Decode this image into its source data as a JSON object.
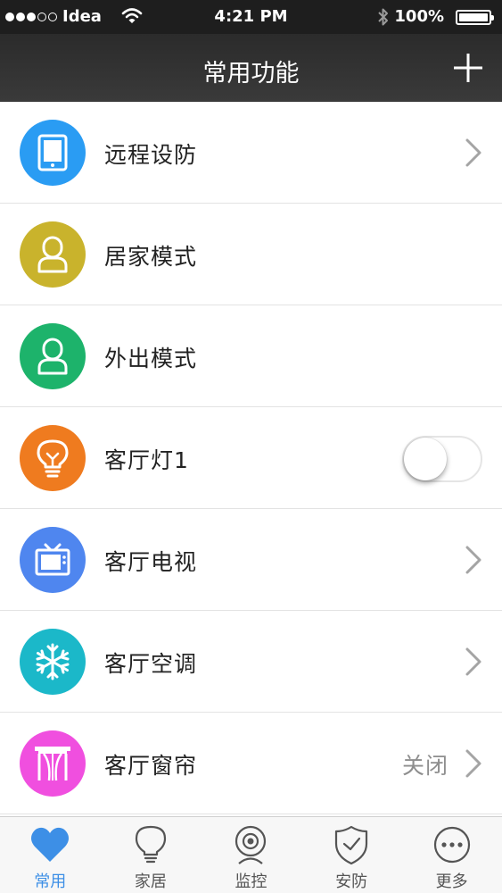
{
  "status_bar": {
    "carrier": "Idea",
    "signal_bars_filled": 3,
    "signal_bars_total": 5,
    "time": "4:21 PM",
    "battery": "100%",
    "battery_level": 1.0
  },
  "header": {
    "title": "常用功能",
    "add_icon": "plus-icon"
  },
  "items": [
    {
      "label": "远程设防",
      "icon": "tablet-icon",
      "color": "#2a9cf3",
      "accessory": "chevron"
    },
    {
      "label": "居家模式",
      "icon": "person-icon",
      "color": "#c9b32c",
      "accessory": "none"
    },
    {
      "label": "外出模式",
      "icon": "person-icon",
      "color": "#1db36b",
      "accessory": "none"
    },
    {
      "label": "客厅灯1",
      "icon": "lightbulb-icon",
      "color": "#ef7b1f",
      "accessory": "toggle",
      "toggle_on": false
    },
    {
      "label": "客厅电视",
      "icon": "tv-icon",
      "color": "#4f86ef",
      "accessory": "chevron"
    },
    {
      "label": "客厅空调",
      "icon": "snowflake-icon",
      "color": "#1bb8c9",
      "accessory": "chevron"
    },
    {
      "label": "客厅窗帘",
      "icon": "curtain-icon",
      "color": "#f04fdf",
      "accessory": "chevron",
      "status": "关闭"
    }
  ],
  "tabs": [
    {
      "label": "常用",
      "icon": "heart-icon",
      "active": true
    },
    {
      "label": "家居",
      "icon": "lightbulb-icon",
      "active": false
    },
    {
      "label": "监控",
      "icon": "camera-icon",
      "active": false
    },
    {
      "label": "安防",
      "icon": "shield-icon",
      "active": false
    },
    {
      "label": "更多",
      "icon": "more-icon",
      "active": false
    }
  ],
  "colors": {
    "accent": "#3d8fe6",
    "navbar": "#2e2e2e",
    "statusbar": "#1e1e1e"
  }
}
